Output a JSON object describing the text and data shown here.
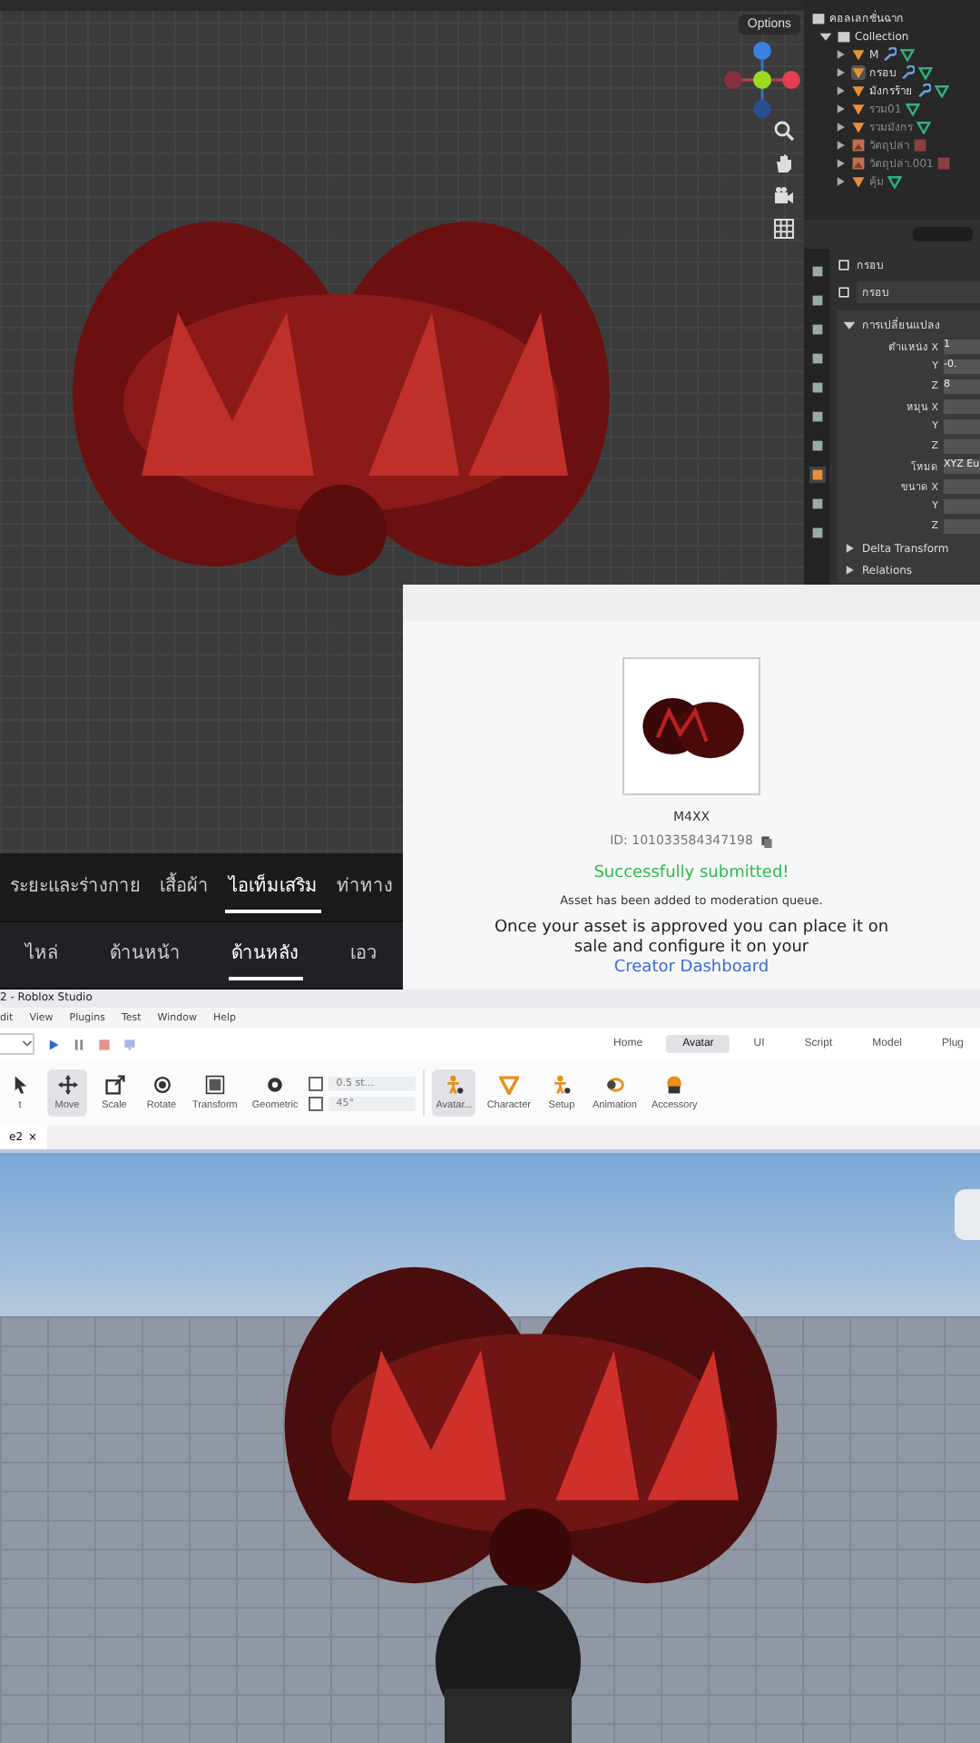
{
  "blender": {
    "options_label": "Options",
    "outliner": {
      "scene_collection": "คอลเลกชั่นฉาก",
      "collection": {
        "name": "Collection",
        "expanded": true,
        "children": [
          {
            "name": "M",
            "kind": "mesh",
            "selected": false,
            "visible": true,
            "modifier": true
          },
          {
            "name": "กรอบ",
            "kind": "mesh",
            "selected": true,
            "visible": true,
            "modifier": true
          },
          {
            "name": "มังกรร้าย",
            "kind": "mesh",
            "selected": false,
            "visible": true,
            "modifier": true
          },
          {
            "name": "รวม01",
            "kind": "mesh",
            "selected": false,
            "visible": false,
            "modifier": false
          },
          {
            "name": "รวมมังกร",
            "kind": "mesh",
            "selected": false,
            "visible": false,
            "modifier": false
          },
          {
            "name": "วัตถุปล่า",
            "kind": "image",
            "selected": false,
            "visible": false,
            "modifier": false
          },
          {
            "name": "วัตถุปล่า.001",
            "kind": "image",
            "selected": false,
            "visible": false,
            "modifier": false
          },
          {
            "name": "คุ้ม",
            "kind": "mesh",
            "selected": false,
            "visible": false,
            "modifier": false
          }
        ]
      }
    },
    "properties": {
      "object_name": "กรอบ",
      "data_name": "กรอบ",
      "panel_title": "การเปลี่ยนแปลง",
      "panel_expanded": true,
      "rows": [
        {
          "label": "ตำแหน่ง X",
          "value": "1"
        },
        {
          "label": "Y",
          "value": "-0."
        },
        {
          "label": "Z",
          "value": "8"
        },
        {
          "label": "หมุน X"
        },
        {
          "label": "Y"
        },
        {
          "label": "Z"
        },
        {
          "label": "โหมด",
          "value": "XYZ Eu"
        },
        {
          "label": "ขนาด X"
        },
        {
          "label": "Y"
        },
        {
          "label": "Z"
        }
      ],
      "subpanels": [
        "Delta Transform",
        "Relations"
      ]
    }
  },
  "avatar_tabs": {
    "categories": [
      {
        "label": "ระยะและร่างกาย",
        "selected": false
      },
      {
        "label": "เสื้อผ้า",
        "selected": false
      },
      {
        "label": "ไอเท็มเสริม",
        "selected": true
      },
      {
        "label": "ท่าทาง",
        "selected": false
      }
    ],
    "subcategories": [
      {
        "label": "ไหล่",
        "selected": false
      },
      {
        "label": "ด้านหน้า",
        "selected": false
      },
      {
        "label": "ด้านหลัง",
        "selected": true
      },
      {
        "label": "เอว",
        "selected": false
      }
    ]
  },
  "submission": {
    "asset_name": "M4XX",
    "asset_id": "ID: 101033584347198",
    "status": "Successfully submitted!",
    "note": "Asset has been added to moderation queue.",
    "message": "Once your asset is approved you can place it on sale and configure it on your",
    "link": "Creator Dashboard"
  },
  "studio": {
    "title": "2 - Roblox Studio",
    "menu": [
      "dit",
      "View",
      "Plugins",
      "Test",
      "Window",
      "Help"
    ],
    "ribbon_tabs": [
      {
        "label": "Home",
        "selected": false
      },
      {
        "label": "Avatar",
        "selected": true
      },
      {
        "label": "UI",
        "selected": false
      },
      {
        "label": "Script",
        "selected": false
      },
      {
        "label": "Model",
        "selected": false
      },
      {
        "label": "Plug",
        "selected": false
      }
    ],
    "tools": [
      {
        "label": "t",
        "kind": "select",
        "selected": false
      },
      {
        "label": "Move",
        "kind": "move",
        "selected": true
      },
      {
        "label": "Scale",
        "kind": "scale",
        "selected": false
      },
      {
        "label": "Rotate",
        "kind": "rotate",
        "selected": false
      },
      {
        "label": "Transform",
        "kind": "transform",
        "selected": false
      },
      {
        "label": "Geometric",
        "kind": "geometric",
        "selected": false
      }
    ],
    "snaps": [
      {
        "value": "0.5 st...",
        "checked": false
      },
      {
        "value": "45°",
        "checked": false
      }
    ],
    "avatar_tools": [
      {
        "label": "Avatar...",
        "kind": "avatar",
        "selected": true
      },
      {
        "label": "Character",
        "kind": "character",
        "selected": false
      },
      {
        "label": "Setup",
        "kind": "setup",
        "selected": false
      },
      {
        "label": "Animation",
        "kind": "animation",
        "selected": false
      },
      {
        "label": "Accessory",
        "kind": "accessory",
        "selected": false
      }
    ],
    "doc_tab": {
      "label": "e2",
      "close": "×"
    }
  }
}
